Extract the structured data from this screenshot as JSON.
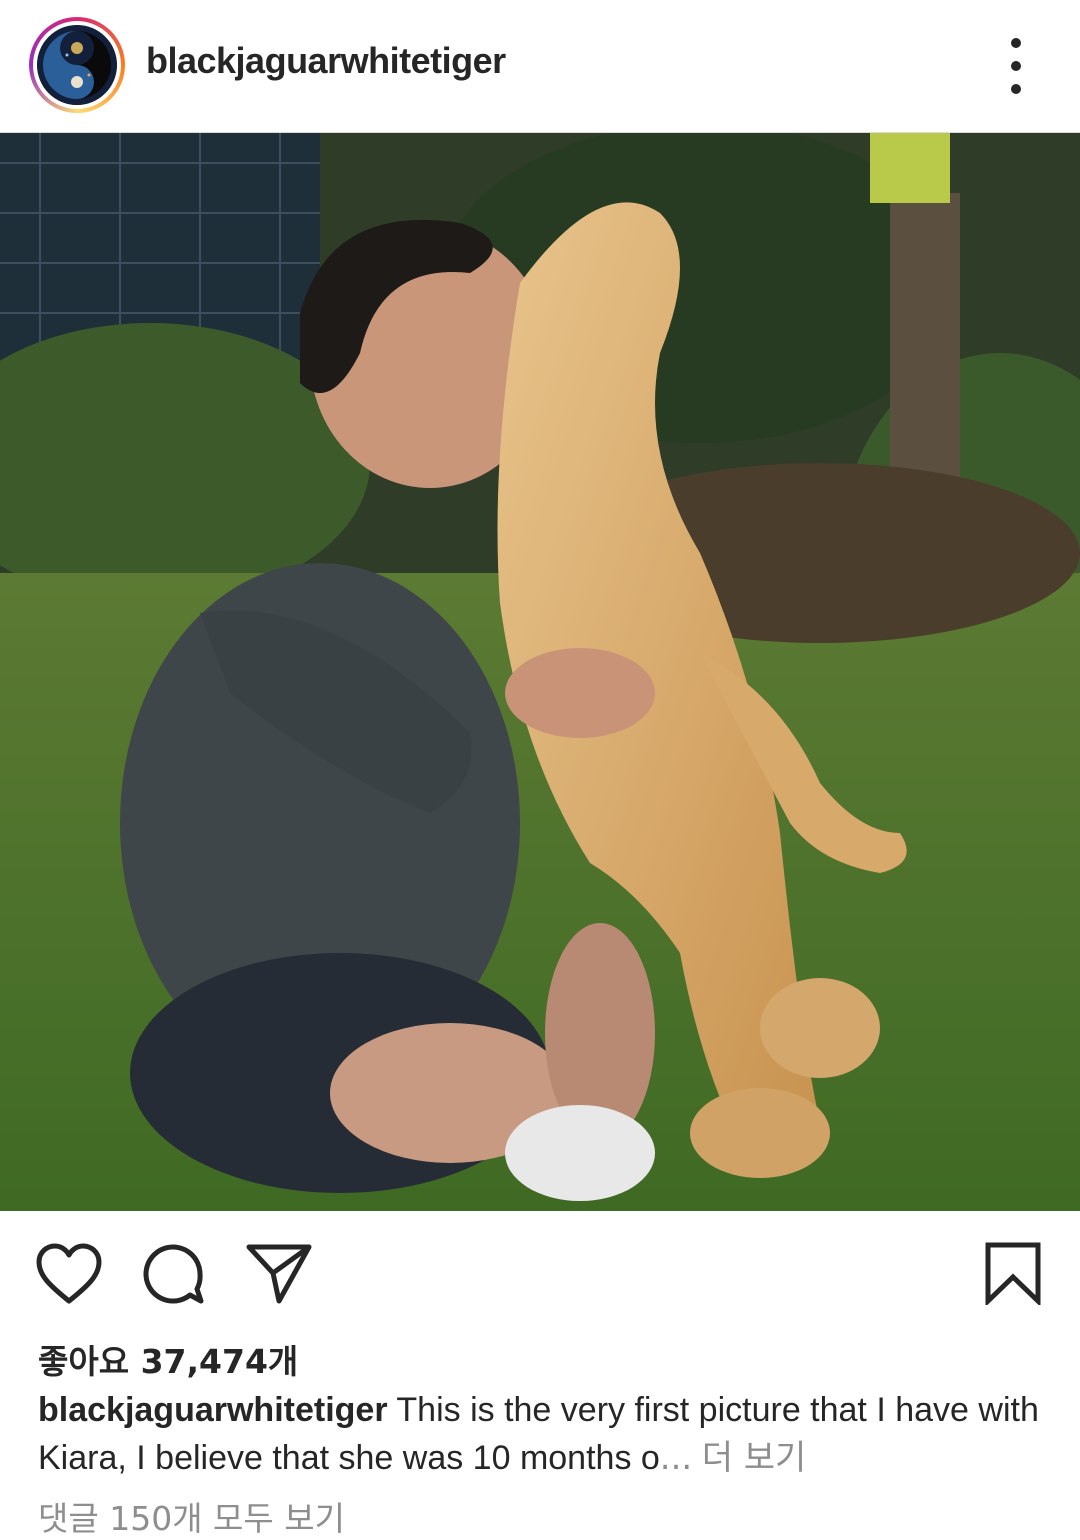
{
  "post": {
    "username": "blackjaguarwhitetiger",
    "avatar_icon": "profile-avatar",
    "more_icon": "more-vertical-icon"
  },
  "actions": {
    "like_icon": "heart-icon",
    "comment_icon": "comment-icon",
    "share_icon": "send-icon",
    "save_icon": "bookmark-icon"
  },
  "likes": {
    "text": "좋아요 37,474개"
  },
  "caption": {
    "username": "blackjaguarwhitetiger",
    "text": "This is the very first picture that I have with Kiara, I believe that she was 10 months o",
    "ellipsis": "...",
    "more_label": "더 보기"
  },
  "comments": {
    "view_all_label": "댓글 150개 모두 보기"
  },
  "colors": {
    "text": "#262626",
    "muted": "#8e8e8e",
    "divider": "#dbdbdb",
    "story_ring": [
      "#d62976",
      "#fa7e1e",
      "#feda75",
      "#962fbf"
    ]
  }
}
